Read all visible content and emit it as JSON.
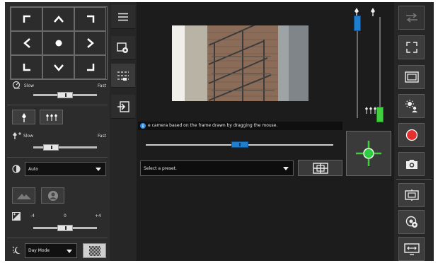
{
  "pan_tilt": {
    "up_icon": "chevron-up",
    "down_icon": "chevron-down",
    "left_icon": "chevron-left",
    "right_icon": "chevron-right",
    "home_icon": "center-dot"
  },
  "pan_speed": {
    "slow_label": "Slow",
    "fast_label": "Fast",
    "value": 0.5
  },
  "zoom_speed": {
    "slow_label": "Slow",
    "fast_label": "Fast",
    "value": 0.2
  },
  "focus": {
    "mode_value": "Auto"
  },
  "exposure": {
    "min_label": "-4",
    "mid_label": "0",
    "max_label": "+4",
    "value": 0.5
  },
  "day_night": {
    "mode_value": "Day Mode"
  },
  "hint": {
    "text": "e camera based on the frame drawn by dragging the mouse."
  },
  "timeline": {
    "value": 0.5
  },
  "preset": {
    "placeholder": "Select a preset."
  },
  "zoom_slider": {
    "value": 0.85
  },
  "focus_slider": {
    "value": 0.08
  },
  "colors": {
    "accent": "#1e7fd0",
    "green": "#3fcf3f",
    "record": "#e53030"
  }
}
